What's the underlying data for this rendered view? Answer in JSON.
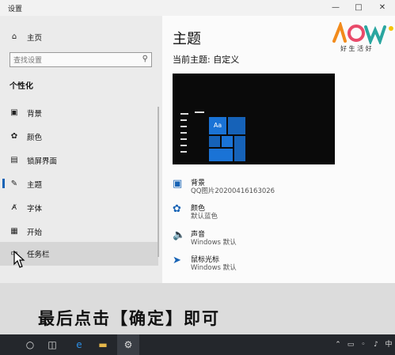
{
  "window": {
    "title": "设置"
  },
  "sidebar": {
    "home_label": "主页",
    "search_placeholder": "查找设置",
    "section_title": "个性化",
    "items": [
      {
        "label": "背景",
        "icon": "image-icon"
      },
      {
        "label": "颜色",
        "icon": "palette-icon"
      },
      {
        "label": "锁屏界面",
        "icon": "lock-screen-icon"
      },
      {
        "label": "主题",
        "icon": "theme-icon",
        "selected": true
      },
      {
        "label": "字体",
        "icon": "font-icon"
      },
      {
        "label": "开始",
        "icon": "start-icon"
      },
      {
        "label": "任务栏",
        "icon": "taskbar-icon",
        "hovered": true
      }
    ]
  },
  "main": {
    "title": "主题",
    "current_theme": "当前主题: 自定义",
    "preview_tile_label": "Aa",
    "settings": [
      {
        "name": "背景",
        "value": "QQ图片20200416163026",
        "icon": "image-icon"
      },
      {
        "name": "颜色",
        "value": "默认蓝色",
        "icon": "palette-icon"
      },
      {
        "name": "声音",
        "value": "Windows 默认",
        "icon": "speaker-icon"
      },
      {
        "name": "鼠标光标",
        "value": "Windows 默认",
        "icon": "cursor-icon"
      }
    ]
  },
  "logo": {
    "text": "好 生 活 好"
  },
  "caption": "最后点击【确定】即可",
  "colors": {
    "accent": "#1763b5",
    "sidebar_bg": "#ebebeb",
    "taskbar_bg": "#24272c"
  }
}
